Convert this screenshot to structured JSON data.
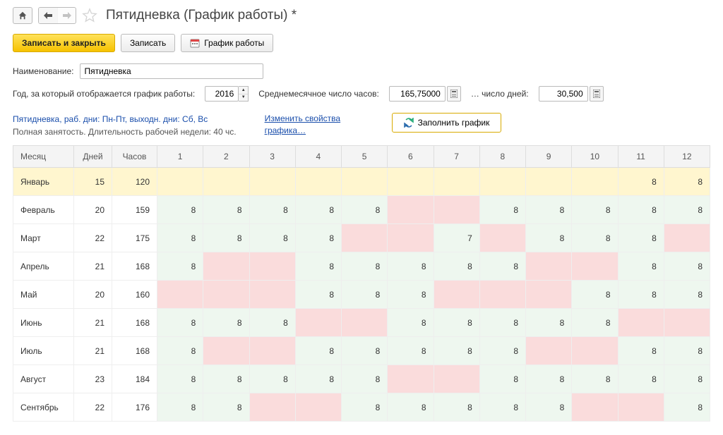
{
  "title": "Пятидневка (График работы) *",
  "buttons": {
    "save_close": "Записать и закрыть",
    "save": "Записать",
    "schedule": "График работы",
    "fill": "Заполнить график"
  },
  "fields": {
    "name_label": "Наименование:",
    "name_value": "Пятидневка",
    "year_label": "Год, за который отображается график работы:",
    "year_value": "2016",
    "avg_hours_label": "Среднемесячное число часов:",
    "avg_hours_value": "165,75000",
    "avg_days_label": "… число дней:",
    "avg_days_value": "30,500"
  },
  "desc": {
    "line1": "Пятидневка, раб. дни: Пн-Пт, выходн. дни: Сб, Вс",
    "line2": "Полная занятость. Длительность рабочей недели: 40 чс.",
    "link": "Изменить свойства графика…"
  },
  "headers": {
    "month": "Месяц",
    "days": "Дней",
    "hours": "Часов",
    "cols": [
      "1",
      "2",
      "3",
      "4",
      "5",
      "6",
      "7",
      "8",
      "9",
      "10",
      "11",
      "12"
    ]
  },
  "rows": [
    {
      "month": "Январь",
      "days": 15,
      "hours": 120,
      "selected": true,
      "cells": [
        {
          "v": "",
          "c": ""
        },
        {
          "v": "",
          "c": ""
        },
        {
          "v": "",
          "c": ""
        },
        {
          "v": "",
          "c": ""
        },
        {
          "v": "",
          "c": ""
        },
        {
          "v": "",
          "c": ""
        },
        {
          "v": "",
          "c": ""
        },
        {
          "v": "",
          "c": ""
        },
        {
          "v": "",
          "c": ""
        },
        {
          "v": "",
          "c": ""
        },
        {
          "v": 8,
          "c": "green"
        },
        {
          "v": 8,
          "c": "green"
        }
      ]
    },
    {
      "month": "Февраль",
      "days": 20,
      "hours": 159,
      "cells": [
        {
          "v": 8,
          "c": "green"
        },
        {
          "v": 8,
          "c": "green"
        },
        {
          "v": 8,
          "c": "green"
        },
        {
          "v": 8,
          "c": "green"
        },
        {
          "v": 8,
          "c": "green"
        },
        {
          "v": "",
          "c": "pink"
        },
        {
          "v": "",
          "c": "pink"
        },
        {
          "v": 8,
          "c": "green"
        },
        {
          "v": 8,
          "c": "green"
        },
        {
          "v": 8,
          "c": "green"
        },
        {
          "v": 8,
          "c": "green"
        },
        {
          "v": 8,
          "c": "green"
        }
      ]
    },
    {
      "month": "Март",
      "days": 22,
      "hours": 175,
      "cells": [
        {
          "v": 8,
          "c": "green"
        },
        {
          "v": 8,
          "c": "green"
        },
        {
          "v": 8,
          "c": "green"
        },
        {
          "v": 8,
          "c": "green"
        },
        {
          "v": "",
          "c": "pink"
        },
        {
          "v": "",
          "c": "pink"
        },
        {
          "v": 7,
          "c": "green"
        },
        {
          "v": "",
          "c": "pink"
        },
        {
          "v": 8,
          "c": "green"
        },
        {
          "v": 8,
          "c": "green"
        },
        {
          "v": 8,
          "c": "green"
        },
        {
          "v": "",
          "c": "pink"
        }
      ]
    },
    {
      "month": "Апрель",
      "days": 21,
      "hours": 168,
      "cells": [
        {
          "v": 8,
          "c": "green"
        },
        {
          "v": "",
          "c": "pink"
        },
        {
          "v": "",
          "c": "pink"
        },
        {
          "v": 8,
          "c": "green"
        },
        {
          "v": 8,
          "c": "green"
        },
        {
          "v": 8,
          "c": "green"
        },
        {
          "v": 8,
          "c": "green"
        },
        {
          "v": 8,
          "c": "green"
        },
        {
          "v": "",
          "c": "pink"
        },
        {
          "v": "",
          "c": "pink"
        },
        {
          "v": 8,
          "c": "green"
        },
        {
          "v": 8,
          "c": "green"
        }
      ]
    },
    {
      "month": "Май",
      "days": 20,
      "hours": 160,
      "cells": [
        {
          "v": "",
          "c": "pink"
        },
        {
          "v": "",
          "c": "pink"
        },
        {
          "v": "",
          "c": "pink"
        },
        {
          "v": 8,
          "c": "green"
        },
        {
          "v": 8,
          "c": "green"
        },
        {
          "v": 8,
          "c": "green"
        },
        {
          "v": "",
          "c": "pink"
        },
        {
          "v": "",
          "c": "pink"
        },
        {
          "v": "",
          "c": "pink"
        },
        {
          "v": 8,
          "c": "green"
        },
        {
          "v": 8,
          "c": "green"
        },
        {
          "v": 8,
          "c": "green"
        }
      ]
    },
    {
      "month": "Июнь",
      "days": 21,
      "hours": 168,
      "cells": [
        {
          "v": 8,
          "c": "green"
        },
        {
          "v": 8,
          "c": "green"
        },
        {
          "v": 8,
          "c": "green"
        },
        {
          "v": "",
          "c": "pink"
        },
        {
          "v": "",
          "c": "pink"
        },
        {
          "v": 8,
          "c": "green"
        },
        {
          "v": 8,
          "c": "green"
        },
        {
          "v": 8,
          "c": "green"
        },
        {
          "v": 8,
          "c": "green"
        },
        {
          "v": 8,
          "c": "green"
        },
        {
          "v": "",
          "c": "pink"
        },
        {
          "v": "",
          "c": "pink"
        }
      ]
    },
    {
      "month": "Июль",
      "days": 21,
      "hours": 168,
      "cells": [
        {
          "v": 8,
          "c": "green"
        },
        {
          "v": "",
          "c": "pink"
        },
        {
          "v": "",
          "c": "pink"
        },
        {
          "v": 8,
          "c": "green"
        },
        {
          "v": 8,
          "c": "green"
        },
        {
          "v": 8,
          "c": "green"
        },
        {
          "v": 8,
          "c": "green"
        },
        {
          "v": 8,
          "c": "green"
        },
        {
          "v": "",
          "c": "pink"
        },
        {
          "v": "",
          "c": "pink"
        },
        {
          "v": 8,
          "c": "green"
        },
        {
          "v": 8,
          "c": "green"
        }
      ]
    },
    {
      "month": "Август",
      "days": 23,
      "hours": 184,
      "cells": [
        {
          "v": 8,
          "c": "green"
        },
        {
          "v": 8,
          "c": "green"
        },
        {
          "v": 8,
          "c": "green"
        },
        {
          "v": 8,
          "c": "green"
        },
        {
          "v": 8,
          "c": "green"
        },
        {
          "v": "",
          "c": "pink"
        },
        {
          "v": "",
          "c": "pink"
        },
        {
          "v": 8,
          "c": "green"
        },
        {
          "v": 8,
          "c": "green"
        },
        {
          "v": 8,
          "c": "green"
        },
        {
          "v": 8,
          "c": "green"
        },
        {
          "v": 8,
          "c": "green"
        }
      ]
    },
    {
      "month": "Сентябрь",
      "days": 22,
      "hours": 176,
      "cells": [
        {
          "v": 8,
          "c": "green"
        },
        {
          "v": 8,
          "c": "green"
        },
        {
          "v": "",
          "c": "pink"
        },
        {
          "v": "",
          "c": "pink"
        },
        {
          "v": 8,
          "c": "green"
        },
        {
          "v": 8,
          "c": "green"
        },
        {
          "v": 8,
          "c": "green"
        },
        {
          "v": 8,
          "c": "green"
        },
        {
          "v": 8,
          "c": "green"
        },
        {
          "v": "",
          "c": "pink"
        },
        {
          "v": "",
          "c": "pink"
        },
        {
          "v": 8,
          "c": "green"
        }
      ]
    }
  ]
}
